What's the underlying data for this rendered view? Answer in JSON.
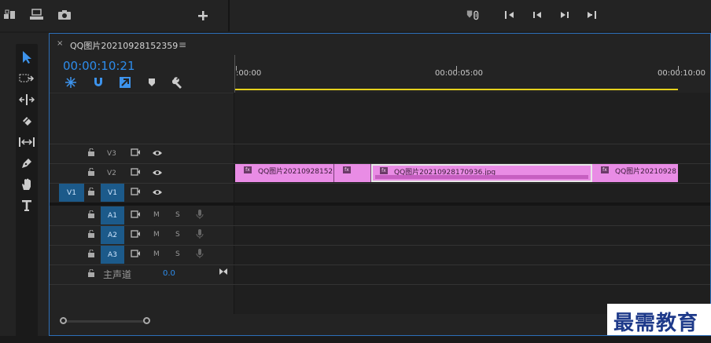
{
  "toolbar": {
    "icons": [
      "export-frame-icon",
      "lift-icon",
      "camera-icon",
      "add-icon",
      "link-markers-icon",
      "step-back-icon",
      "play-back-icon",
      "play-forward-icon",
      "step-forward-icon"
    ]
  },
  "tools": [
    "selection-tool-icon",
    "track-select-tool-icon",
    "ripple-edit-tool-icon",
    "razor-tool-icon",
    "slip-tool-icon",
    "pen-tool-icon",
    "hand-tool-icon",
    "type-tool-icon"
  ],
  "sequence": {
    "close": "×",
    "name": "QQ图片20210928152359",
    "menu": "≡",
    "timecode": "00:00:10:21"
  },
  "ruler": {
    "ticks": [
      ":00:00",
      "00:00:05:00",
      "00:00:10:00"
    ]
  },
  "tracks": {
    "video": [
      {
        "label": "V3"
      },
      {
        "label": "V2"
      },
      {
        "label": "V1",
        "source": "V1"
      }
    ],
    "audio": [
      {
        "label": "A1",
        "m": "M",
        "s": "S"
      },
      {
        "label": "A2",
        "m": "M",
        "s": "S"
      },
      {
        "label": "A3",
        "m": "M",
        "s": "S"
      }
    ],
    "master": {
      "label": "主声道",
      "value": "0.0"
    }
  },
  "clips": [
    {
      "label": "QQ图片20210928152",
      "fx": "fx"
    },
    {
      "label": "",
      "fx": "fx"
    },
    {
      "label": "QQ图片20210928170936.jpg",
      "fx": "fx"
    },
    {
      "label": "QQ图片20210928",
      "fx": "fx"
    }
  ],
  "watermark": "最需教育",
  "colors": {
    "accent_blue": "#2d8ceb",
    "clip_pink": "#e98ce5",
    "work_area_yellow": "#e6d21c"
  }
}
